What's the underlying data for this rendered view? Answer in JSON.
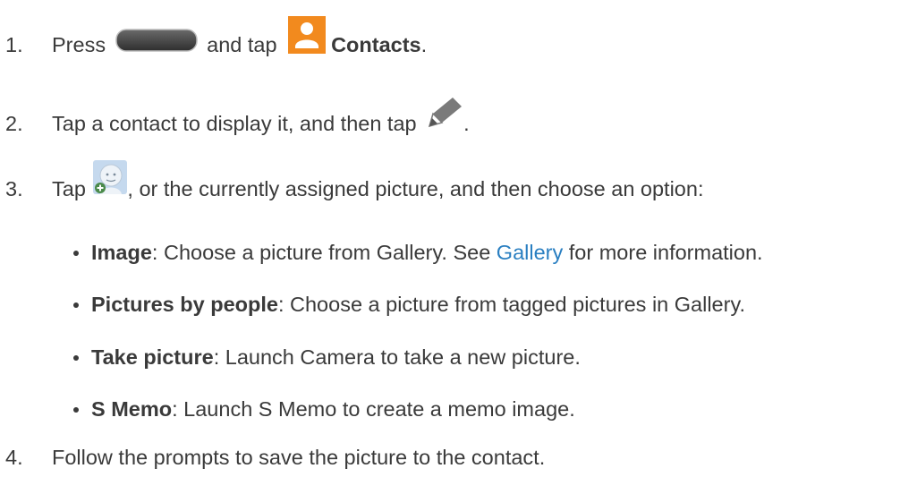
{
  "steps": [
    {
      "number": "1.",
      "parts": [
        "Press",
        "and tap",
        "Contacts",
        "."
      ]
    },
    {
      "number": "2.",
      "parts": [
        "Tap a contact to display it, and then tap",
        "."
      ]
    },
    {
      "number": "3.",
      "parts": [
        "Tap",
        ", or the currently assigned picture, and then choose an option:"
      ]
    },
    {
      "number": "4.",
      "parts": [
        "Follow the prompts to save the picture to the contact."
      ]
    }
  ],
  "options": [
    {
      "title": "Image",
      "text_before_link": ": Choose a picture from Gallery. See ",
      "link": "Gallery",
      "text_after_link": " for more information."
    },
    {
      "title": "Pictures by people",
      "text": ": Choose a picture from tagged pictures in Gallery."
    },
    {
      "title": "Take picture",
      "text": ": Launch Camera to take a new picture."
    },
    {
      "title": "S Memo",
      "text": ": Launch S Memo to create a memo image."
    }
  ],
  "icons": {
    "home_button": "home-key",
    "contacts": "contacts-app",
    "edit": "pencil",
    "add_picture": "add-contact-photo"
  },
  "colors": {
    "text": "#3a3a3a",
    "link": "#2a7fc1",
    "contacts_icon": "#f28a1e"
  }
}
